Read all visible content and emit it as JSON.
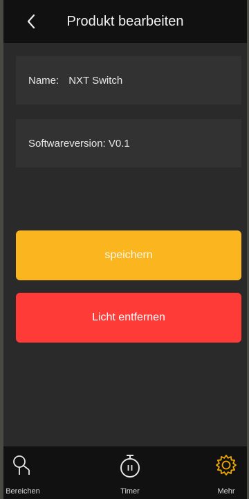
{
  "header": {
    "title": "Produkt bearbeiten",
    "back_icon": "chevron-left-icon"
  },
  "product": {
    "name_label": "Name:",
    "name_value": "NXT Switch",
    "software_version": "Softwareversion: V0.1"
  },
  "buttons": {
    "save_label": "speichern",
    "remove_label": "Licht entfernen"
  },
  "tabbar": {
    "items": [
      {
        "label": "Bereichen",
        "icon": "lamp-icon",
        "active": false
      },
      {
        "label": "Timer",
        "icon": "stopwatch-icon",
        "active": false
      },
      {
        "label": "Mehr",
        "icon": "gear-icon",
        "active": true
      }
    ]
  },
  "colors": {
    "header_bg": "#111111",
    "page_bg": "#2a2a2a",
    "card_bg": "#323232",
    "save": "#fbb61f",
    "remove": "#ff3b38",
    "accent": "#f2a900"
  }
}
